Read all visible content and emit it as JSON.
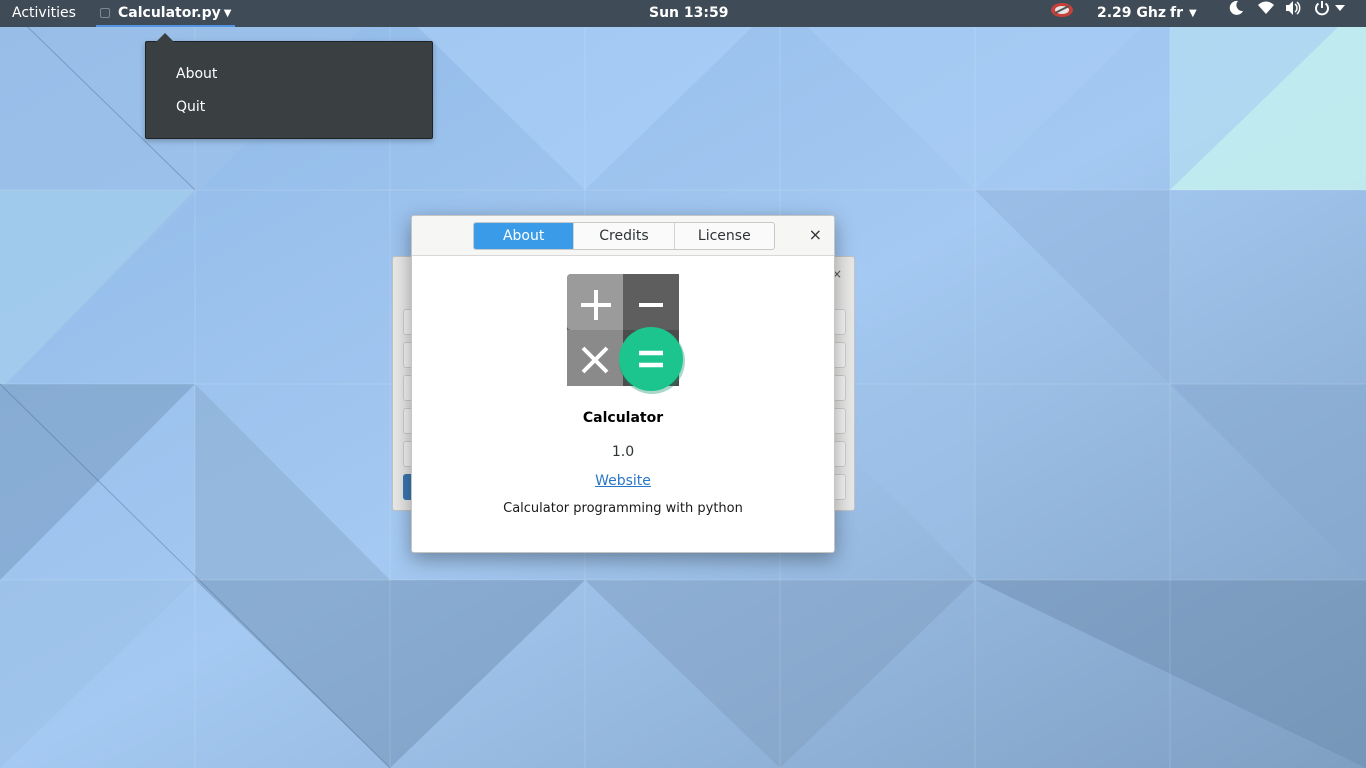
{
  "topbar": {
    "activities_label": "Activities",
    "app_menu_label": "Calculator.py",
    "clock": "Sun 13:59",
    "cpu_freq": "2.29 Ghz",
    "language": "fr"
  },
  "app_menu": {
    "items": [
      {
        "label": "About"
      },
      {
        "label": "Quit"
      }
    ]
  },
  "about_dialog": {
    "tabs": [
      {
        "label": "About",
        "active": true
      },
      {
        "label": "Credits",
        "active": false
      },
      {
        "label": "License",
        "active": false
      }
    ],
    "close_glyph": "×",
    "program_name": "Calculator",
    "version": "1.0",
    "website_label": "Website",
    "comments": "Calculator programming with python"
  },
  "calculator_window": {
    "close_glyph": "×"
  },
  "icons": {
    "topbar": [
      "cpufreq-icon",
      "night-mode-icon",
      "wifi-icon",
      "volume-icon",
      "power-icon"
    ],
    "logo": "calculator-logo"
  },
  "colors": {
    "topbar_bg": "#3f4b56",
    "accent_blue": "#3a9ce8",
    "logo_green": "#1cc48e",
    "menu_bg": "#3a3f42",
    "link_blue": "#2a76c6"
  }
}
